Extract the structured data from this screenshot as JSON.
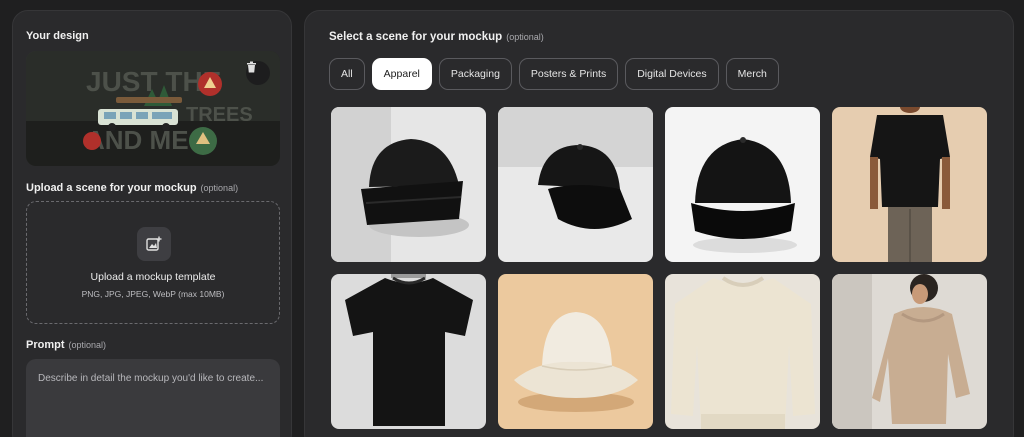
{
  "left": {
    "design_title": "Your design",
    "upload_section_title": "Upload a scene for your mockup",
    "upload_section_optional": "(optional)",
    "upload_box_title": "Upload a mockup template",
    "upload_box_formats": "PNG, JPG, JPEG, WebP (max 10MB)",
    "prompt_title": "Prompt",
    "prompt_optional": "(optional)",
    "prompt_placeholder": "Describe in detail the mockup you'd like to create..."
  },
  "design_art": {
    "line1": "JUST THE",
    "line2": "TREES",
    "line3": "AND ME"
  },
  "right": {
    "title": "Select a scene for your mockup",
    "title_optional": "(optional)",
    "tabs": [
      {
        "label": "All",
        "active": false
      },
      {
        "label": "Apparel",
        "active": true
      },
      {
        "label": "Packaging",
        "active": false
      },
      {
        "label": "Posters & Prints",
        "active": false
      },
      {
        "label": "Digital Devices",
        "active": false
      },
      {
        "label": "Merch",
        "active": false
      }
    ]
  },
  "scenes": [
    {
      "name": "black beanie",
      "bg": "#e6e6e6"
    },
    {
      "name": "black snapback cap",
      "bg": "#e9e9e9"
    },
    {
      "name": "black baseball cap",
      "bg": "#f4f4f4"
    },
    {
      "name": "model in black t-shirt",
      "bg": "#e6cdb0"
    },
    {
      "name": "black t-shirt",
      "bg": "#dcdcdc"
    },
    {
      "name": "cream bucket hat",
      "bg": "#ecc99e"
    },
    {
      "name": "cream sweatshirt",
      "bg": "#e8e3da"
    },
    {
      "name": "model in beige hoodie",
      "bg": "#dedad4"
    }
  ],
  "colors": {
    "accent_active_tab": "#ffffff",
    "panel": "#2a2a2c",
    "background": "#1f1f20"
  }
}
